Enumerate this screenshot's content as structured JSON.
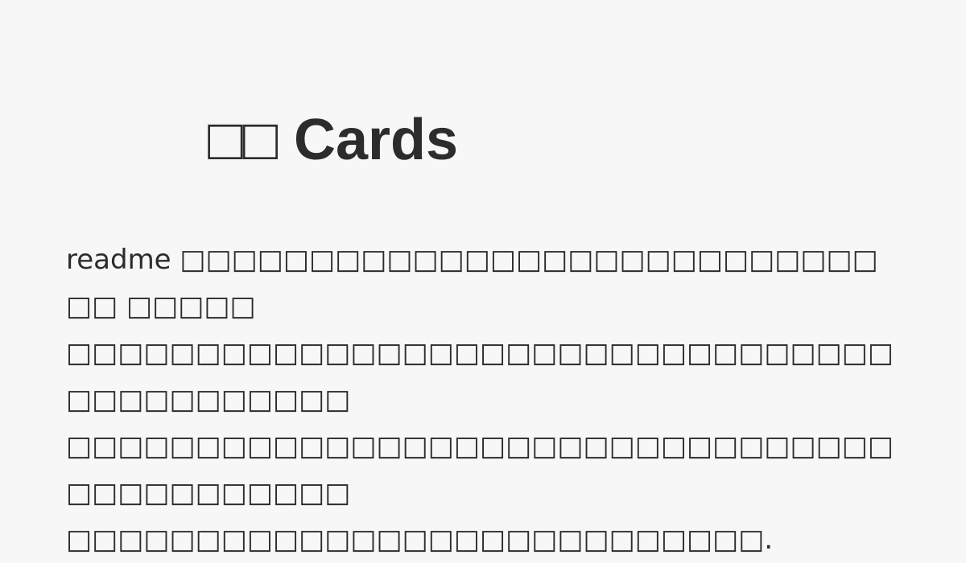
{
  "card": {
    "title": "□□ Cards",
    "description": "readme □□□□□□□□□□□□□□□□□□□□□□□□□□□□□ □□□□□\n□□□□□□□□□□□□□□□□□□□□□□□□□□□□□□□□□□□□□□□□□□□\n□□□□□□□□□□□□□□□□□□□□□□□□□□□□□□□□□□□□□□□□□□□\n□□□□□□□□□□□□□□□□□□□□□□□□□□□."
  },
  "colors": {
    "background": "#f8f7f8",
    "text": "#2c2c2c"
  }
}
